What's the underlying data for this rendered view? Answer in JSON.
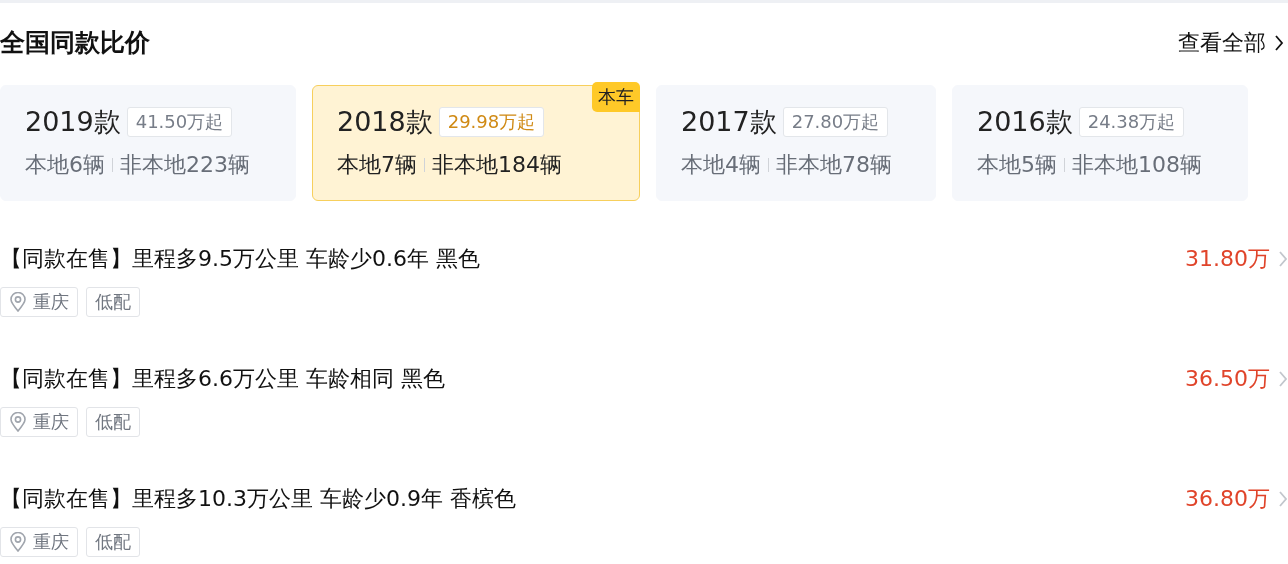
{
  "header": {
    "title": "全国同款比价",
    "link": "查看全部"
  },
  "years": [
    {
      "year": "2019款",
      "price": "41.50万起",
      "local": "本地6辆",
      "nonlocal": "非本地223辆",
      "selected": false
    },
    {
      "year": "2018款",
      "price": "29.98万起",
      "local": "本地7辆",
      "nonlocal": "非本地184辆",
      "selected": true,
      "badge": "本车"
    },
    {
      "year": "2017款",
      "price": "27.80万起",
      "local": "本地4辆",
      "nonlocal": "非本地78辆",
      "selected": false
    },
    {
      "year": "2016款",
      "price": "24.38万起",
      "local": "本地5辆",
      "nonlocal": "非本地108辆",
      "selected": false
    }
  ],
  "listings": [
    {
      "title": "【同款在售】里程多9.5万公里 车龄少0.6年 黑色",
      "price": "31.80万",
      "tags": [
        {
          "kind": "location",
          "label": "重庆"
        },
        {
          "kind": "plain",
          "label": "低配"
        }
      ]
    },
    {
      "title": "【同款在售】里程多6.6万公里 车龄相同 黑色",
      "price": "36.50万",
      "tags": [
        {
          "kind": "location",
          "label": "重庆"
        },
        {
          "kind": "plain",
          "label": "低配"
        }
      ]
    },
    {
      "title": "【同款在售】里程多10.3万公里 车龄少0.9年 香槟色",
      "price": "36.80万",
      "tags": [
        {
          "kind": "location",
          "label": "重庆"
        },
        {
          "kind": "plain",
          "label": "低配"
        }
      ]
    }
  ]
}
